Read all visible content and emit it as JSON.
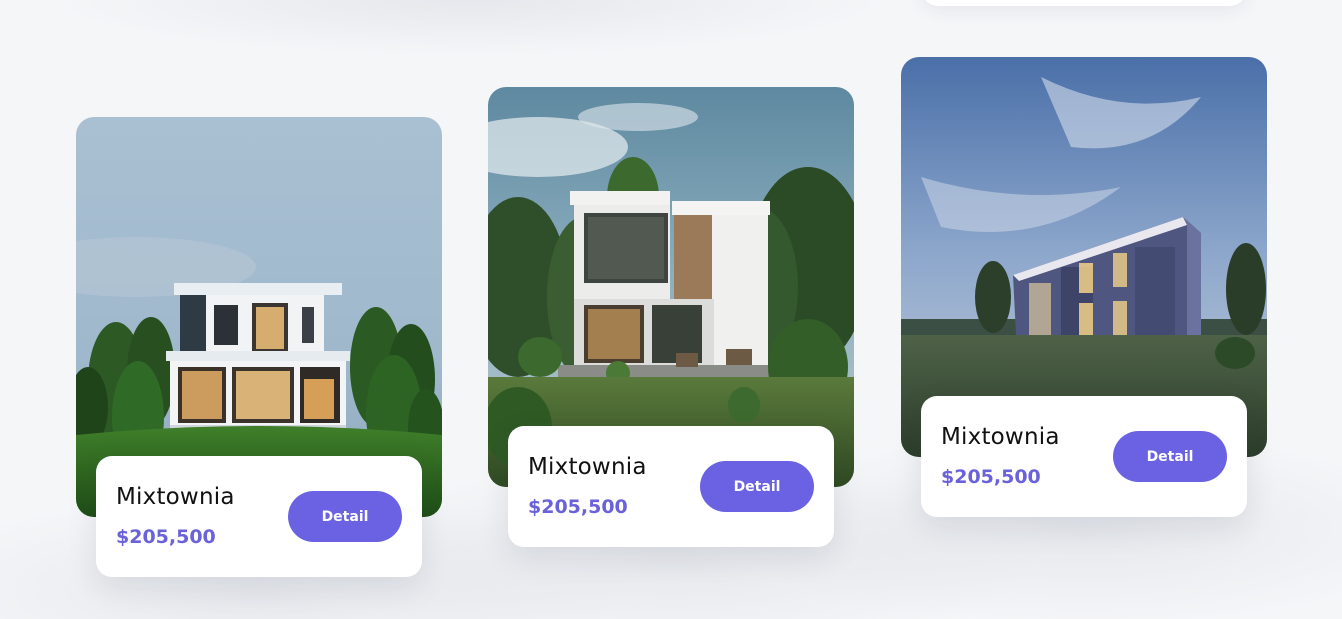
{
  "colors": {
    "accent": "#6a62e3",
    "price": "#6a62d8",
    "page_background": "#f5f6f8",
    "card_background": "#ffffff"
  },
  "listings": [
    {
      "name": "Mixtownia",
      "price": "$205,500",
      "button_label": "Detail"
    },
    {
      "name": "Mixtownia",
      "price": "$205,500",
      "button_label": "Detail"
    },
    {
      "name": "Mixtownia",
      "price": "$205,500",
      "button_label": "Detail"
    }
  ]
}
